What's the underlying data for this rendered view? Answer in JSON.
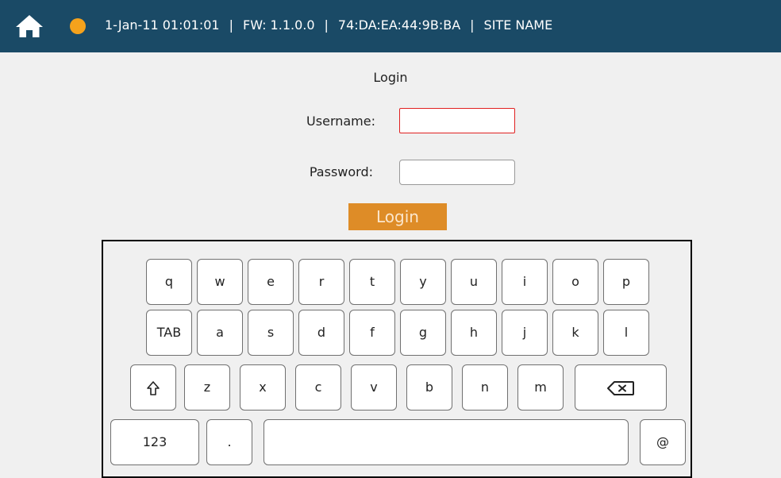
{
  "header": {
    "background_color": "#1a4a66",
    "home_icon": "home-icon",
    "status_indicator_color": "#f5a21c",
    "datetime": "1-Jan-11 01:01:01",
    "separator": "|",
    "firmware": "FW: 1.1.0.0",
    "mac_address": "74:DA:EA:44:9B:BA",
    "site_name": "SITE NAME"
  },
  "login": {
    "title": "Login",
    "username_label": "Username:",
    "username_value": "",
    "password_label": "Password:",
    "password_value": "",
    "submit_label": "Login",
    "submit_color": "#de8c27",
    "error_border_color": "#e02020"
  },
  "keyboard": {
    "row1": [
      "q",
      "w",
      "e",
      "r",
      "t",
      "y",
      "u",
      "i",
      "o",
      "p"
    ],
    "row2": [
      "TAB",
      "a",
      "s",
      "d",
      "f",
      "g",
      "h",
      "j",
      "k",
      "l"
    ],
    "row3_shift_icon": "shift-arrow-icon",
    "row3": [
      "z",
      "x",
      "c",
      "v",
      "b",
      "n",
      "m"
    ],
    "row3_backspace_icon": "backspace-icon",
    "row4_numbers": "123",
    "row4_period": ".",
    "row4_space": "",
    "row4_at": "@"
  }
}
